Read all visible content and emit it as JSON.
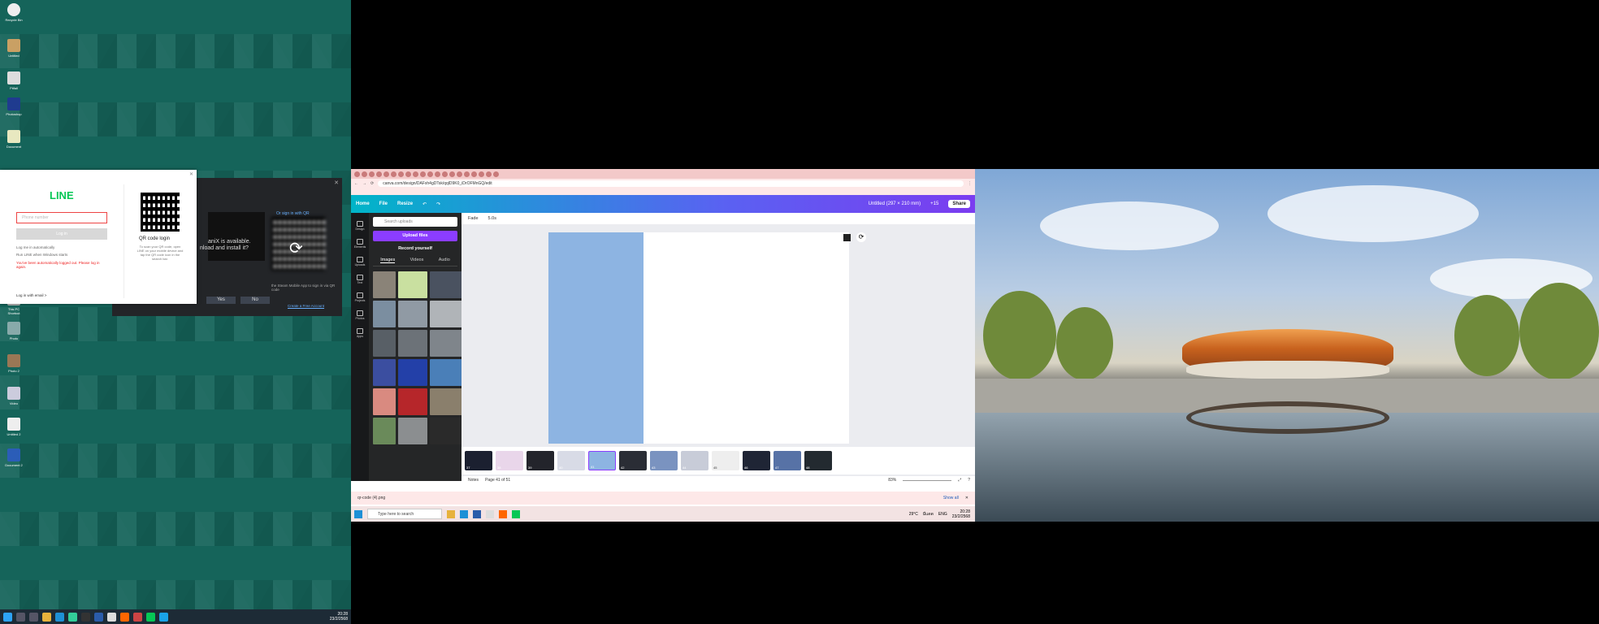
{
  "desktop": {
    "icons": [
      "Recycle Bin",
      "Untitled",
      "Pitfall",
      "Photoshop",
      "Document",
      "This PC Shortcut",
      "Photo",
      "Photo 2",
      "Video",
      "Untitled 2",
      "Document 2"
    ],
    "taskbar_time": "20:28",
    "taskbar_date": "23/2/2568"
  },
  "line": {
    "logo": "LINE",
    "phone_placeholder": "Phone number",
    "login_button": "Log in",
    "keep_logged": "Log me in automatically",
    "run_startup": "Run LINE when Windows starts",
    "error": "You've been automatically logged out. Please log in again.",
    "email_link": "Log in with email >",
    "qr_title": "QR code login",
    "qr_desc": "To scan your QR code, open LINE on your mobile device and tap the QR code icon in the search bar."
  },
  "dialog": {
    "text1": "aniX is available.",
    "text2": "nload and install it?",
    "yes": "Yes",
    "no": "No",
    "signin": "Or sign in with QR",
    "mobile": "the Steam Mobile App to sign in via QR code",
    "create": "Create a Free Account"
  },
  "browser": {
    "url": "canva.com/design/DAFxh4gDTsk/qqlD9K0_iDrOFMnGQ/edit"
  },
  "canva": {
    "home": "Home",
    "file": "File",
    "resize": "Resize",
    "doc_title": "Untitled (297 × 210 mm)",
    "count": "+15",
    "share": "Share",
    "rail": [
      "Design",
      "Elements",
      "Uploads",
      "Text",
      "Projects",
      "Photos",
      "Apps"
    ],
    "search_placeholder": "Search uploads",
    "upload_btn": "Upload files",
    "record": "Record yourself",
    "tabs": [
      "Images",
      "Videos",
      "Audio"
    ],
    "fade": "Fade",
    "duration": "5.0s",
    "strip_nums": [
      "37",
      "38",
      "39",
      "40",
      "41",
      "42",
      "43",
      "44",
      "45",
      "46",
      "47",
      "48"
    ],
    "notes": "Notes",
    "page_indicator": "Page 41 of 51",
    "zoom": "83%"
  },
  "download": {
    "file": "qr-code (4).png",
    "show_all": "Show all"
  },
  "wtaskbar": {
    "search": "Type here to search",
    "temp": "29°C",
    "weather": "มีแดด",
    "lang": "ENG",
    "time": "20:28",
    "date": "23/2/2568"
  },
  "colors": {
    "line_green": "#06c755",
    "canva_purple": "#8b3dff",
    "page_blue": "#8db4e2"
  }
}
